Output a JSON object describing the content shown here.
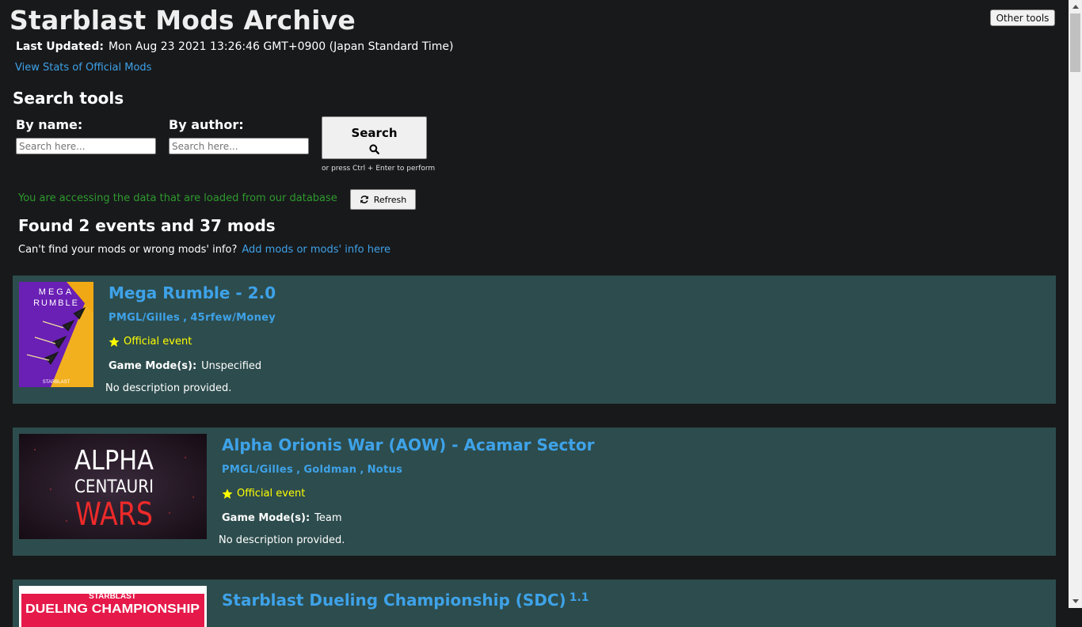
{
  "header": {
    "title": "Starblast Mods Archive",
    "other_tools_label": "Other tools",
    "last_updated_label": "Last Updated:",
    "last_updated_value": "Mon Aug 23 2021 13:26:46 GMT+0900 (Japan Standard Time)",
    "stats_link": "View Stats of Official Mods"
  },
  "search": {
    "title": "Search tools",
    "name_label": "By name:",
    "name_placeholder": "Search here...",
    "author_label": "By author:",
    "author_placeholder": "Search here...",
    "button_label": "Search",
    "hint": "or press Ctrl + Enter to perform"
  },
  "status": {
    "db_message": "You are accessing the data that are loaded from our database",
    "refresh_label": "Refresh",
    "found": "Found 2 events and 37 mods",
    "cant_find": "Can't find your mods or wrong mods' info?",
    "add_link": "Add mods or mods' info here"
  },
  "mods": [
    {
      "title": "Mega Rumble - 2.0",
      "authors": [
        "PMGL/Gilles",
        "45rfew/Money"
      ],
      "official": "Official event",
      "game_mode_label": "Game Mode(s):",
      "game_mode": "Unspecified",
      "description": "No description provided.",
      "thumb_text": [
        "MEGA",
        "RUMBLE"
      ],
      "thumb_footer": "STARBLAST"
    },
    {
      "title": "Alpha Orionis War (AOW) - Acamar Sector",
      "authors": [
        "PMGL/Gilles",
        "Goldman",
        "Notus"
      ],
      "official": "Official event",
      "game_mode_label": "Game Mode(s):",
      "game_mode": "Team",
      "description": "No description provided.",
      "thumb_text": [
        "ALPHA",
        "CENTAURI",
        "WARS"
      ]
    },
    {
      "title": "Starblast Dueling Championship (SDC)",
      "version": "1.1",
      "thumb_text": [
        "STARBLAST",
        "DUELING CHAMPIONSHIP"
      ]
    }
  ],
  "colors": {
    "background": "#18191b",
    "card": "#2d4c4d",
    "link": "#3ea2e8",
    "official": "#ffff00",
    "db_message": "#2e9a2e"
  }
}
